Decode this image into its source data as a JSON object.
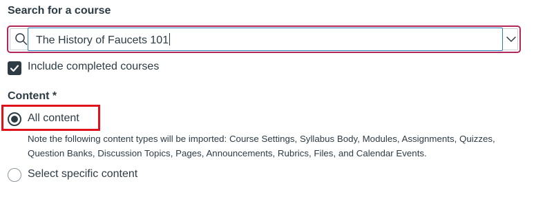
{
  "search": {
    "label": "Search for a course",
    "value": "The History of Faucets 101"
  },
  "include_completed": {
    "label": "Include completed courses",
    "checked": true
  },
  "content": {
    "label": "Content *",
    "options": [
      {
        "label": "All content",
        "selected": true,
        "note": "Note the following content types will be imported: Course Settings, Syllabus Body, Modules, Assignments, Quizzes, Question Banks, Discussion Topics, Pages, Announcements, Rubrics, Files, and Calendar Events."
      },
      {
        "label": "Select specific content",
        "selected": false
      }
    ]
  },
  "icons": {
    "search": "search-icon",
    "dropdown": "chevron-down-icon",
    "checkbox": "checkmark-icon"
  },
  "colors": {
    "focus_ring": "#b3265a",
    "field_border": "#2b7abc",
    "text": "#2d3b45",
    "highlight": "#e0111b"
  }
}
